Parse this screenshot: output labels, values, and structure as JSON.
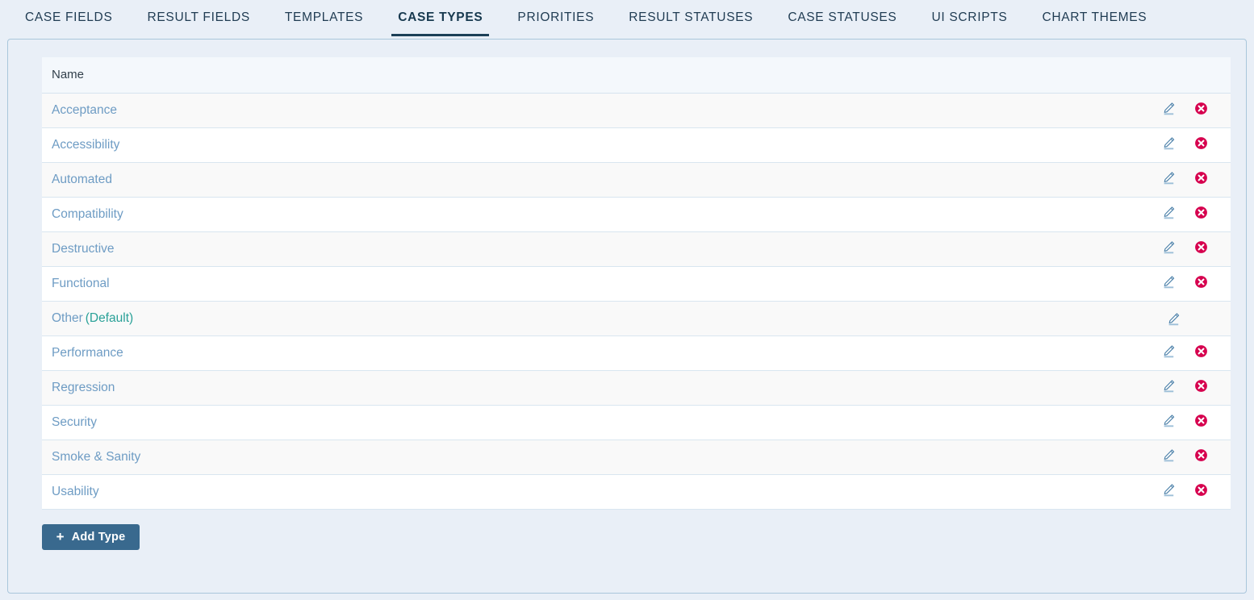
{
  "tabs": [
    {
      "label": "CASE FIELDS",
      "active": false
    },
    {
      "label": "RESULT FIELDS",
      "active": false
    },
    {
      "label": "TEMPLATES",
      "active": false
    },
    {
      "label": "CASE TYPES",
      "active": true
    },
    {
      "label": "PRIORITIES",
      "active": false
    },
    {
      "label": "RESULT STATUSES",
      "active": false
    },
    {
      "label": "CASE STATUSES",
      "active": false
    },
    {
      "label": "UI SCRIPTS",
      "active": false
    },
    {
      "label": "CHART THEMES",
      "active": false
    }
  ],
  "table": {
    "columns": [
      "Name"
    ],
    "rows": [
      {
        "name": "Acceptance",
        "default_label": "",
        "can_edit": true,
        "can_delete": true
      },
      {
        "name": "Accessibility",
        "default_label": "",
        "can_edit": true,
        "can_delete": true
      },
      {
        "name": "Automated",
        "default_label": "",
        "can_edit": true,
        "can_delete": true
      },
      {
        "name": "Compatibility",
        "default_label": "",
        "can_edit": true,
        "can_delete": true
      },
      {
        "name": "Destructive",
        "default_label": "",
        "can_edit": true,
        "can_delete": true
      },
      {
        "name": "Functional",
        "default_label": "",
        "can_edit": true,
        "can_delete": true
      },
      {
        "name": "Other",
        "default_label": "(Default)",
        "can_edit": true,
        "can_delete": false
      },
      {
        "name": "Performance",
        "default_label": "",
        "can_edit": true,
        "can_delete": true
      },
      {
        "name": "Regression",
        "default_label": "",
        "can_edit": true,
        "can_delete": true
      },
      {
        "name": "Security",
        "default_label": "",
        "can_edit": true,
        "can_delete": true
      },
      {
        "name": "Smoke & Sanity",
        "default_label": "",
        "can_edit": true,
        "can_delete": true
      },
      {
        "name": "Usability",
        "default_label": "",
        "can_edit": true,
        "can_delete": true
      }
    ]
  },
  "add_button": {
    "label": "Add Type",
    "icon": "plus-icon",
    "plus": "+"
  },
  "icons": {
    "edit": "pencil-edit-icon",
    "delete": "delete-circle-icon"
  },
  "colors": {
    "page_background": "#e9eff7",
    "panel_border": "#a9c6db",
    "table_header_bg": "#f4f8fc",
    "row_odd_bg": "#f9f9f9",
    "row_even_bg": "#ffffff",
    "row_border": "#d9e6f0",
    "link_blue": "#6e9cc4",
    "default_teal": "#2aa198",
    "delete_red": "#d6004e",
    "edit_blue": "#4a7fa8",
    "active_tab_underline": "#1b4057",
    "tab_text": "#1f3b52",
    "button_bg": "#39698e"
  }
}
